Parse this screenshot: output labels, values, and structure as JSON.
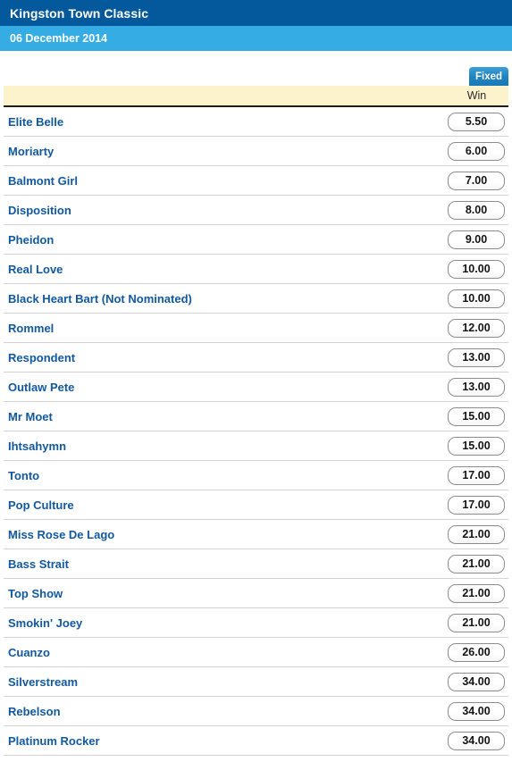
{
  "header": {
    "title": "Kingston Town Classic",
    "date": "06 December 2014"
  },
  "tabs": [
    {
      "label": "Fixed",
      "selected": true
    }
  ],
  "columns": {
    "win_label": "Win"
  },
  "colors": {
    "title_bar": "#04599c",
    "date_bar": "#35ace4",
    "tab_active": "#1f82c0",
    "column_header_band": "#fcf3cd",
    "runner_name": "#11589f",
    "row_divider": "#d3d3d3"
  },
  "runners": [
    {
      "name": "Elite Belle",
      "win": "5.50"
    },
    {
      "name": "Moriarty",
      "win": "6.00"
    },
    {
      "name": "Balmont Girl",
      "win": "7.00"
    },
    {
      "name": "Disposition",
      "win": "8.00"
    },
    {
      "name": "Pheidon",
      "win": "9.00"
    },
    {
      "name": "Real Love",
      "win": "10.00"
    },
    {
      "name": "Black Heart Bart (Not Nominated)",
      "win": "10.00"
    },
    {
      "name": "Rommel",
      "win": "12.00"
    },
    {
      "name": "Respondent",
      "win": "13.00"
    },
    {
      "name": "Outlaw Pete",
      "win": "13.00"
    },
    {
      "name": "Mr Moet",
      "win": "15.00"
    },
    {
      "name": "Ihtsahymn",
      "win": "15.00"
    },
    {
      "name": "Tonto",
      "win": "17.00"
    },
    {
      "name": "Pop Culture",
      "win": "17.00"
    },
    {
      "name": "Miss Rose De Lago",
      "win": "21.00"
    },
    {
      "name": "Bass Strait",
      "win": "21.00"
    },
    {
      "name": "Top Show",
      "win": "21.00"
    },
    {
      "name": "Smokin' Joey",
      "win": "21.00"
    },
    {
      "name": "Cuanzo",
      "win": "26.00"
    },
    {
      "name": "Silverstream",
      "win": "34.00"
    },
    {
      "name": "Rebelson",
      "win": "34.00"
    },
    {
      "name": "Platinum Rocker",
      "win": "34.00"
    }
  ]
}
